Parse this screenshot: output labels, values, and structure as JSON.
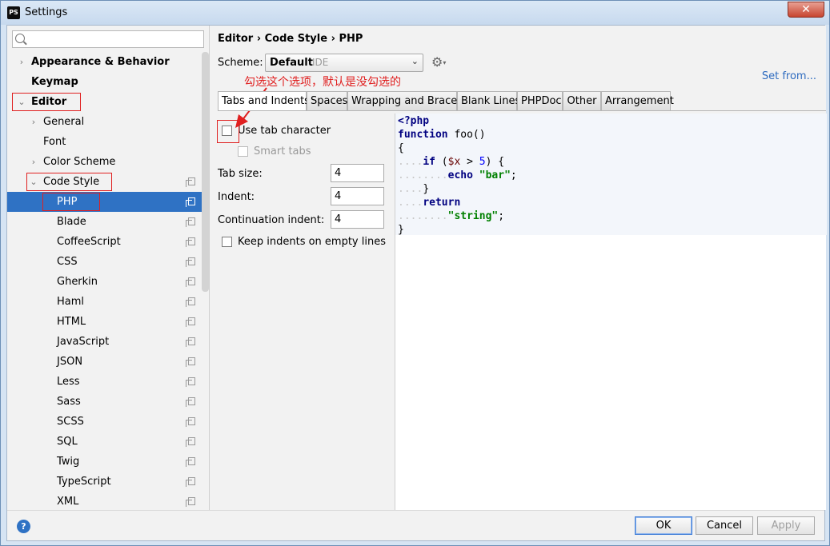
{
  "window": {
    "title": "Settings",
    "app_icon": "PS",
    "close_glyph": "✕"
  },
  "search": {
    "placeholder": ""
  },
  "sidebar": {
    "items": [
      {
        "label": "Appearance & Behavior"
      },
      {
        "label": "Keymap"
      },
      {
        "label": "Editor"
      },
      {
        "label": "General"
      },
      {
        "label": "Font"
      },
      {
        "label": "Color Scheme"
      },
      {
        "label": "Code Style"
      },
      {
        "label": "PHP"
      },
      {
        "label": "Blade"
      },
      {
        "label": "CoffeeScript"
      },
      {
        "label": "CSS"
      },
      {
        "label": "Gherkin"
      },
      {
        "label": "Haml"
      },
      {
        "label": "HTML"
      },
      {
        "label": "JavaScript"
      },
      {
        "label": "JSON"
      },
      {
        "label": "Less"
      },
      {
        "label": "Sass"
      },
      {
        "label": "SCSS"
      },
      {
        "label": "SQL"
      },
      {
        "label": "Twig"
      },
      {
        "label": "TypeScript"
      },
      {
        "label": "XML"
      }
    ]
  },
  "breadcrumb": {
    "text": "Editor › Code Style › PHP"
  },
  "scheme": {
    "label": "Scheme:",
    "value": "Default",
    "descriptor": "IDE"
  },
  "set_from": "Set from...",
  "annotation": "勾选这个选项，默认是没勾选的",
  "tabs": [
    {
      "label": "Tabs and Indents"
    },
    {
      "label": "Spaces"
    },
    {
      "label": "Wrapping and Braces"
    },
    {
      "label": "Blank Lines"
    },
    {
      "label": "PHPDoc"
    },
    {
      "label": "Other"
    },
    {
      "label": "Arrangement"
    }
  ],
  "options": {
    "use_tab": "Use tab character",
    "smart_tabs": "Smart tabs",
    "tab_size_label": "Tab size:",
    "tab_size": "4",
    "indent_label": "Indent:",
    "indent": "4",
    "continuation_label": "Continuation indent:",
    "continuation": "4",
    "keep_indents": "Keep indents on empty lines"
  },
  "code": {
    "l1": "<?php",
    "l2": "function foo()",
    "l3": "{",
    "l4_kw": "if",
    "l4_a": " (",
    "l4_var": "$x",
    "l4_b": " > ",
    "l4_num": "5",
    "l4_c": ") {",
    "l5_kw": "echo",
    "l5_str": "\"bar\"",
    "l5_end": ";",
    "l6": "}",
    "l7_kw": "return",
    "l8_str": "\"string\"",
    "l8_end": ";",
    "l9": "}"
  },
  "buttons": {
    "ok": "OK",
    "cancel": "Cancel",
    "apply": "Apply",
    "help": "?"
  },
  "colors": {
    "selection": "#2f72c4",
    "annotation": "#e02020",
    "link": "#2e6bbf"
  }
}
